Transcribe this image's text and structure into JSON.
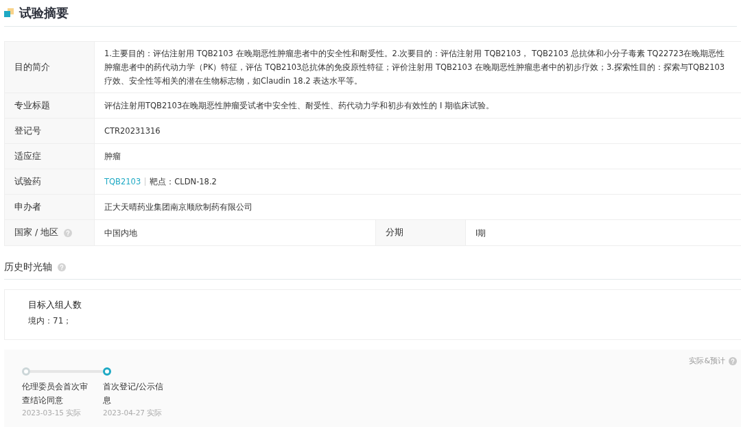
{
  "section_title": "试验摘要",
  "summary_rows": [
    {
      "label": "目的简介",
      "value": "1.主要目的：评估注射用 TQB2103 在晚期恶性肿瘤患者中的安全性和耐受性。2.次要目的：评估注射用 TQB2103， TQB2103 总抗体和小分子毒素 TQ22723在晚期恶性肿瘤患者中的药代动力学（PK）特征，评估 TQB2103总抗体的免疫原性特征；评价注射用 TQB2103 在晚期恶性肿瘤患者中的初步疗效；3.探索性目的：探索与TQB2103 疗效、安全性等相关的潜在生物标志物，如Claudin 18.2 表达水平等。"
    },
    {
      "label": "专业标题",
      "value": "评估注射用TQB2103在晚期恶性肿瘤受试者中安全性、耐受性、药代动力学和初步有效性的 I 期临床试验。"
    },
    {
      "label": "登记号",
      "value": "CTR20231316"
    },
    {
      "label": "适应症",
      "value": "肿瘤"
    },
    {
      "label": "试验药",
      "drug_link": "TQB2103",
      "target": "靶点：CLDN-18.2"
    },
    {
      "label": "申办者",
      "value": "正大天晴药业集团南京顺欣制药有限公司"
    }
  ],
  "region_row": {
    "label": "国家 / 地区",
    "value": "中国内地",
    "phase_label": "分期",
    "phase_value": "I期"
  },
  "history_title": "历史时光轴",
  "enrollment": {
    "title": "目标入组人数",
    "value": "境内：71；"
  },
  "timeline": {
    "legend": "实际&预计",
    "steps": [
      {
        "title": "伦理委员会首次审查结论同意",
        "date": "2023-03-15 实际",
        "selected": false
      },
      {
        "title": "首次登记/公示信息",
        "date": "2023-04-27 实际",
        "selected": true
      }
    ]
  }
}
